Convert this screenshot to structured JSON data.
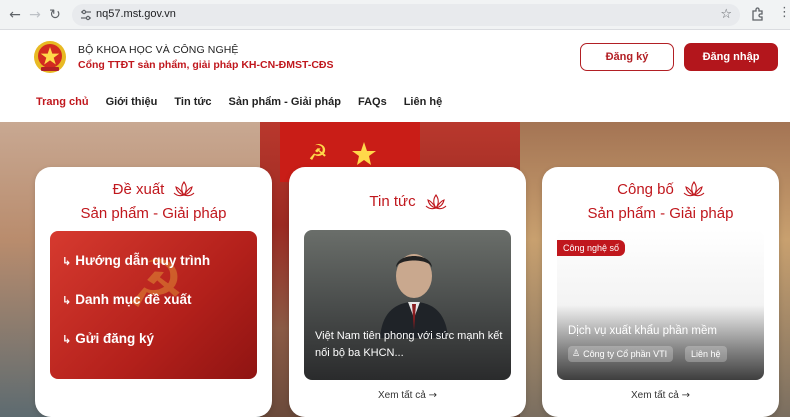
{
  "browser": {
    "url": "nq57.mst.gov.vn"
  },
  "header": {
    "org_name": "BỘ KHOA HỌC VÀ CÔNG NGHỆ",
    "portal_name": "Cổng TTĐT sản phẩm, giải pháp KH-CN-ĐMST-CĐS",
    "register_label": "Đăng ký",
    "login_label": "Đăng nhập"
  },
  "menu": {
    "items": [
      {
        "label": "Trang chủ",
        "active": true
      },
      {
        "label": "Giới thiệu"
      },
      {
        "label": "Tin tức"
      },
      {
        "label": "Sản phẩm - Giải pháp"
      },
      {
        "label": "FAQs"
      },
      {
        "label": "Liên hệ"
      }
    ]
  },
  "cards": {
    "proposal": {
      "title_line1": "Đề xuất",
      "title_line2": "Sản phẩm - Giải pháp",
      "links": [
        "Hướng dẫn quy trình",
        "Danh mục đề xuất",
        "Gửi đăng ký"
      ]
    },
    "news": {
      "title": "Tin tức",
      "caption": "Việt Nam tiên phong với sức mạnh kết nối bộ ba KHCN...",
      "see_all": "Xem tất cả"
    },
    "announce": {
      "title_line1": "Công bố",
      "title_line2": "Sản phẩm - Giải pháp",
      "tag": "Công nghệ số",
      "item_title": "Dịch vụ xuất khẩu phần mềm",
      "company": "Công ty Cổ phần VTI",
      "contact": "Liên hệ",
      "see_all": "Xem tất cả"
    }
  },
  "colors": {
    "brand_red": "#c0171d",
    "button_red": "#b3161c"
  }
}
